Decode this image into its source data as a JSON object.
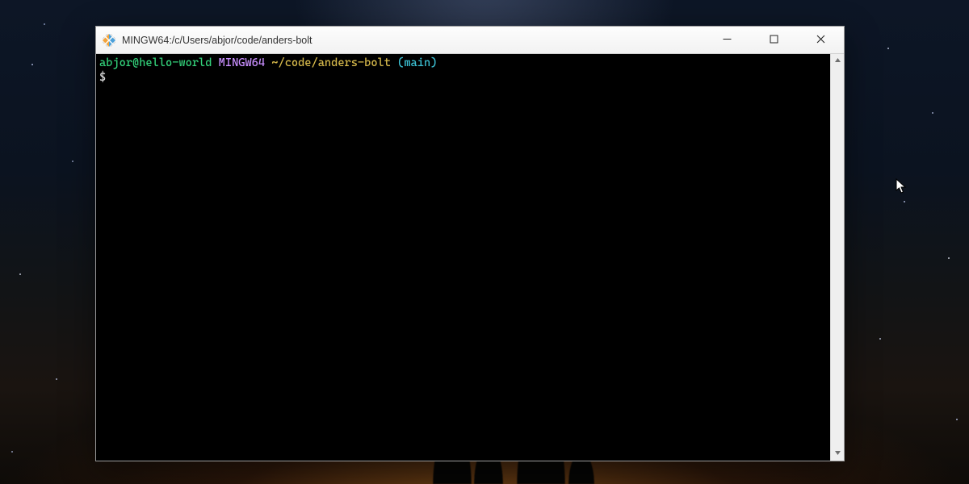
{
  "window": {
    "title": "MINGW64:/c/Users/abjor/code/anders-bolt"
  },
  "prompt": {
    "user_host": "abjor@hello-world",
    "env": "MINGW64",
    "path": "~/code/anders-bolt",
    "branch_open": "(",
    "branch": "main",
    "branch_close": ")",
    "symbol": "$"
  },
  "icons": {
    "app": "git-bash-icon",
    "minimize": "minimize-icon",
    "maximize": "maximize-icon",
    "close": "close-icon",
    "scroll_up": "scroll-up-icon",
    "scroll_down": "scroll-down-icon",
    "cursor": "mouse-pointer-icon"
  }
}
